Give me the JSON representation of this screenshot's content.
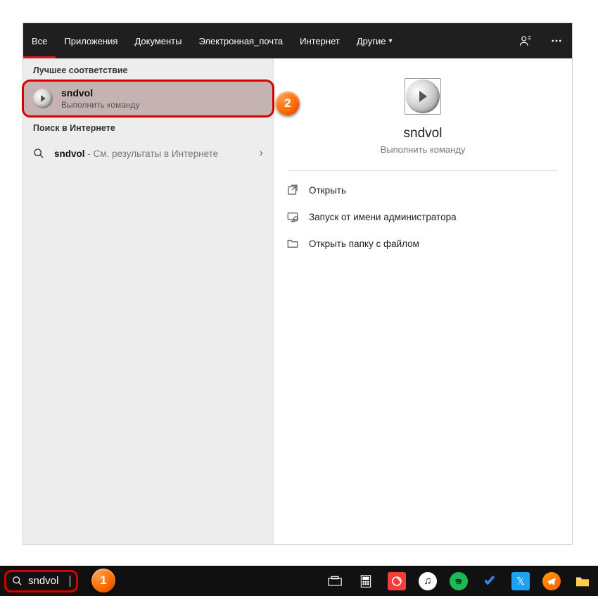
{
  "tabs": {
    "all": "Все",
    "apps": "Приложения",
    "documents": "Документы",
    "email": "Электронная_почта",
    "internet": "Интернет",
    "more": "Другие"
  },
  "left": {
    "best_match_header": "Лучшее соответствие",
    "result_title": "sndvol",
    "result_sub": "Выполнить команду",
    "web_header": "Поиск в Интернете",
    "web_query": "sndvol",
    "web_suffix": " - См. результаты в Интернете"
  },
  "right": {
    "title": "sndvol",
    "sub": "Выполнить команду",
    "actions": {
      "open": "Открыть",
      "run_admin": "Запуск от имени администратора",
      "open_folder": "Открыть папку с файлом"
    }
  },
  "search": {
    "value": "sndvol"
  },
  "markers": {
    "one": "1",
    "two": "2"
  },
  "colors": {
    "accent": "#d40000",
    "marker": "#ff6a00"
  }
}
